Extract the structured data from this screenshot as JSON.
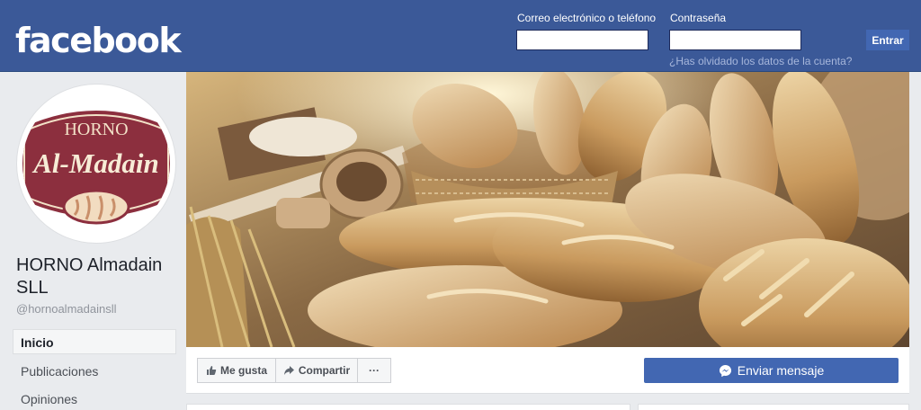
{
  "header": {
    "logo": "facebook",
    "email_label": "Correo electrónico o teléfono",
    "password_label": "Contraseña",
    "login_button": "Entrar",
    "forgot_link": "¿Has olvidado los datos de la cuenta?"
  },
  "page": {
    "name": "HORNO Almadain SLL",
    "username": "@hornoalmadainsll",
    "logo_text_top": "HORNO",
    "logo_text_main": "Al-Madain"
  },
  "nav": {
    "items": [
      {
        "label": "Inicio"
      },
      {
        "label": "Publicaciones"
      },
      {
        "label": "Opiniones"
      }
    ]
  },
  "actions": {
    "like": "Me gusta",
    "share": "Compartir",
    "more": "···",
    "message": "Enviar mensaje"
  },
  "colors": {
    "brand_blue": "#3b5998",
    "button_blue": "#4267b2",
    "logo_burgundy": "#8c2f3e"
  }
}
